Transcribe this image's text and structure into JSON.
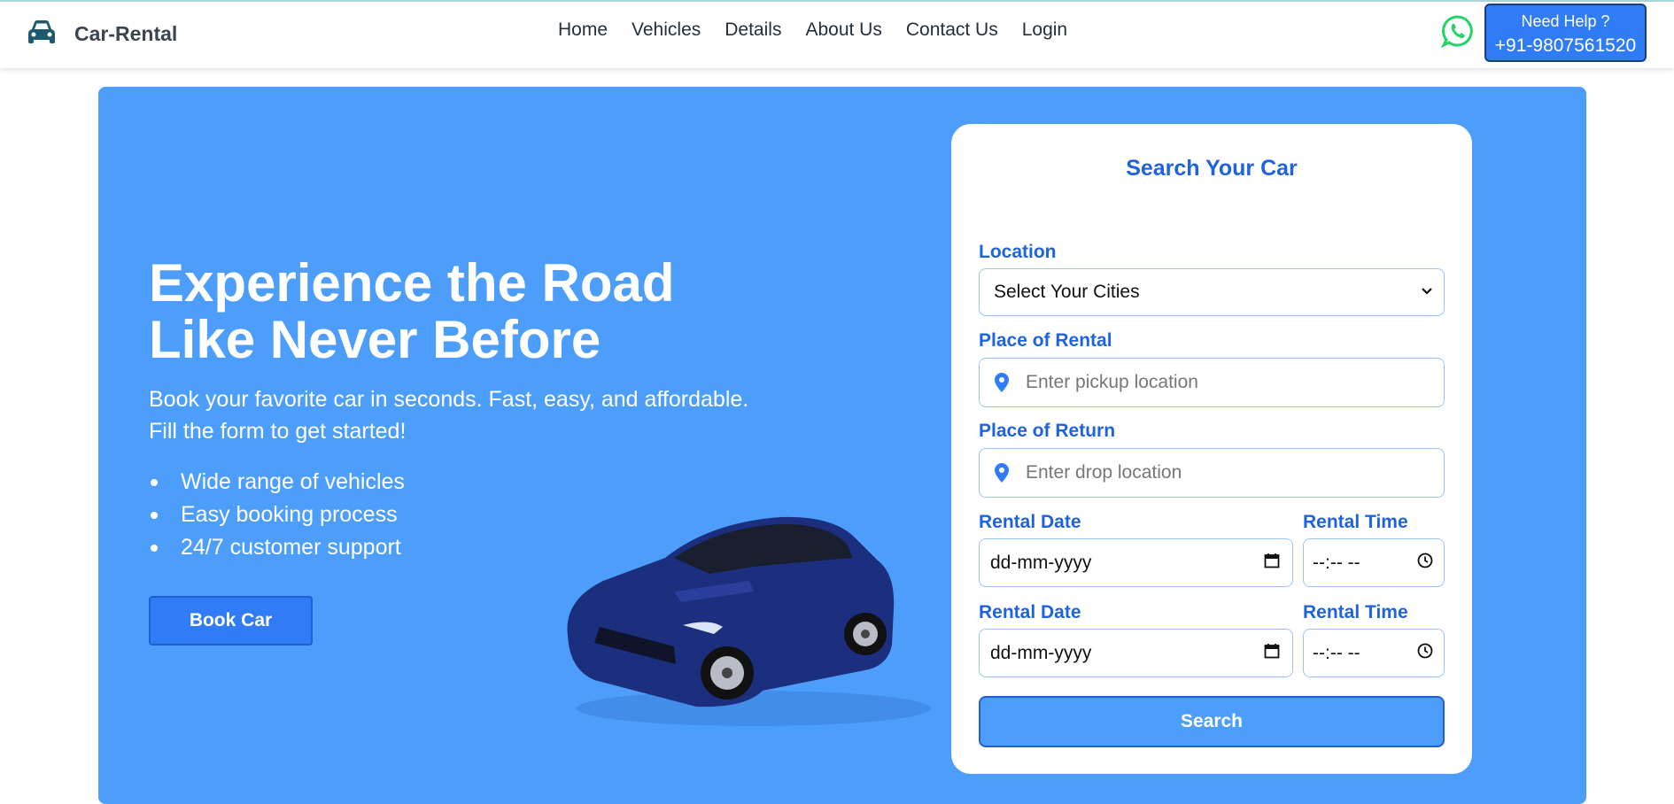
{
  "brand": {
    "name": "Car-Rental",
    "icon": "car-icon"
  },
  "nav": {
    "items": [
      {
        "label": "Home"
      },
      {
        "label": "Vehicles"
      },
      {
        "label": "Details"
      },
      {
        "label": "About Us"
      },
      {
        "label": "Contact Us"
      },
      {
        "label": "Login"
      }
    ]
  },
  "help": {
    "title": "Need Help ?",
    "phone": "+91-9807561520",
    "icon": "whatsapp-icon"
  },
  "hero": {
    "headline_line1": "Experience the Road",
    "headline_line2": "Like Never Before",
    "sub_line1": "Book your favorite car in seconds. Fast, easy, and affordable.",
    "sub_line2": "Fill the form to get started!",
    "features": [
      "Wide range of vehicles",
      "Easy booking process",
      "24/7 customer support"
    ],
    "book_label": "Book Car"
  },
  "search": {
    "title": "Search Your Car",
    "location_label": "Location",
    "location_value": "Select Your Cities",
    "rental_place_label": "Place of Rental",
    "rental_place_placeholder": "Enter pickup location",
    "return_place_label": "Place of Return",
    "return_place_placeholder": "Enter drop location",
    "date1_label": "Rental Date",
    "date1_value": "dd-mm-yyyy",
    "time1_label": "Rental Time",
    "time1_value": "--:-- --",
    "date2_label": "Rental Date",
    "date2_value": "dd-mm-yyyy",
    "time2_label": "Rental Time",
    "time2_value": "--:-- --",
    "search_label": "Search"
  },
  "colors": {
    "accent": "#2f7cf6",
    "hero_bg": "#4d9dfb",
    "label": "#1f63df",
    "whatsapp": "#25d366"
  }
}
